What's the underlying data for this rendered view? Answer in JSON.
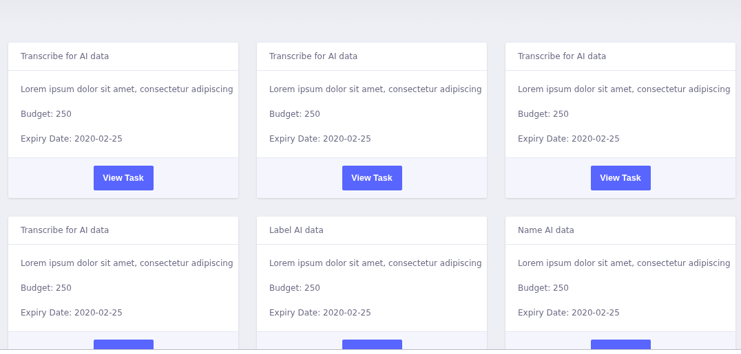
{
  "cards": [
    {
      "title": "Transcribe for AI data",
      "description": "Lorem ipsum dolor sit amet, consectetur adipiscing",
      "budget": "Budget: 250",
      "expiry": "Expiry Date: 2020-02-25",
      "button": "View Task"
    },
    {
      "title": "Transcribe for AI data",
      "description": "Lorem ipsum dolor sit amet, consectetur adipiscing",
      "budget": "Budget: 250",
      "expiry": "Expiry Date: 2020-02-25",
      "button": "View Task"
    },
    {
      "title": "Transcribe for AI data",
      "description": "Lorem ipsum dolor sit amet, consectetur adipiscing",
      "budget": "Budget: 250",
      "expiry": "Expiry Date: 2020-02-25",
      "button": "View Task"
    },
    {
      "title": "Transcribe for AI data",
      "description": "Lorem ipsum dolor sit amet, consectetur adipiscing",
      "budget": "Budget: 250",
      "expiry": "Expiry Date: 2020-02-25"
    },
    {
      "title": "Label AI data",
      "description": "Lorem ipsum dolor sit amet, consectetur adipiscing",
      "budget": "Budget: 250",
      "expiry": "Expiry Date: 2020-02-25"
    },
    {
      "title": "Name AI data",
      "description": "Lorem ipsum dolor sit amet, consectetur adipiscing",
      "budget": "Budget: 250",
      "expiry": "Expiry Date: 2020-02-25"
    }
  ]
}
